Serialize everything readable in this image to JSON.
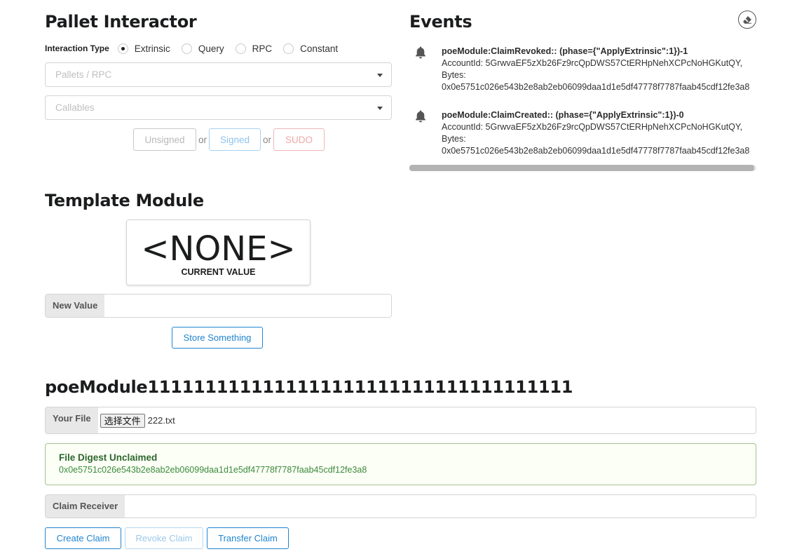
{
  "pallet_interactor": {
    "title": "Pallet Interactor",
    "interaction_type_label": "Interaction Type",
    "interaction_types": [
      {
        "label": "Extrinsic",
        "checked": true
      },
      {
        "label": "Query",
        "checked": false
      },
      {
        "label": "RPC",
        "checked": false
      },
      {
        "label": "Constant",
        "checked": false
      }
    ],
    "pallets_placeholder": "Pallets / RPC",
    "callables_placeholder": "Callables",
    "buttons": {
      "unsigned": "Unsigned",
      "signed": "Signed",
      "sudo": "SUDO"
    },
    "or_text": "or"
  },
  "events": {
    "title": "Events",
    "clear_icon": "eraser-icon",
    "items": [
      {
        "icon": "bell-icon",
        "head": "poeModule:ClaimRevoked:: (phase={\"ApplyExtrinsic\":1})-1",
        "line1": "AccountId: 5GrwvaEF5zXb26Fz9rcQpDWS57CtERHpNehXCPcNoHGKutQY,",
        "line2": "Bytes:",
        "line3": "0x0e5751c026e543b2e8ab2eb06099daa1d1e5df47778f7787faab45cdf12fe3a8"
      },
      {
        "icon": "bell-icon",
        "head": "poeModule:ClaimCreated:: (phase={\"ApplyExtrinsic\":1})-0",
        "line1": "AccountId: 5GrwvaEF5zXb26Fz9rcQpDWS57CtERHpNehXCPcNoHGKutQY,",
        "line2": "Bytes:",
        "line3": "0x0e5751c026e543b2e8ab2eb06099daa1d1e5df47778f7787faab45cdf12fe3a8"
      }
    ]
  },
  "template_module": {
    "title": "Template Module",
    "current_value": "<NONE>",
    "current_value_label": "CURRENT VALUE",
    "new_value_label": "New Value",
    "new_value": "",
    "store_button": "Store Something"
  },
  "poe_module": {
    "title": "poeModule1111111111111111111111111111111111111",
    "your_file_label": "Your File",
    "choose_file_button": "选择文件",
    "file_name": "222.txt",
    "digest_header": "File Digest Unclaimed",
    "digest_value": "0x0e5751c026e543b2e8ab2eb06099daa1d1e5df47778f7787faab45cdf12fe3a8",
    "claim_receiver_label": "Claim Receiver",
    "claim_receiver_value": "",
    "buttons": {
      "create": "Create Claim",
      "revoke": "Revoke Claim",
      "transfer": "Transfer Claim"
    }
  }
}
